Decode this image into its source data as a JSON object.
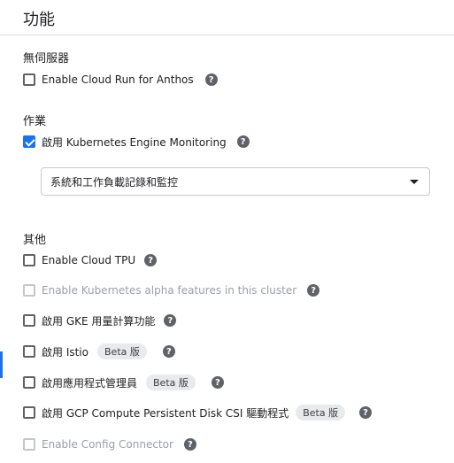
{
  "title": "功能",
  "sections": {
    "serverless": {
      "title": "無伺服器",
      "items": [
        {
          "label": "Enable Cloud Run for Anthos",
          "checked": false,
          "disabled": false
        }
      ]
    },
    "operations": {
      "title": "作業",
      "items": [
        {
          "label": "啟用 Kubernetes Engine Monitoring",
          "checked": true,
          "disabled": false
        }
      ],
      "select": {
        "value": "系統和工作負載記錄和監控"
      }
    },
    "other": {
      "title": "其他",
      "items": [
        {
          "label": "Enable Cloud TPU",
          "checked": false,
          "disabled": false
        },
        {
          "label": "Enable Kubernetes alpha features in this cluster",
          "checked": false,
          "disabled": true
        },
        {
          "label": "啟用 GKE 用量計算功能",
          "checked": false,
          "disabled": false
        },
        {
          "label": "啟用 Istio",
          "checked": false,
          "disabled": false,
          "badge": "Beta 版"
        },
        {
          "label": "啟用應用程式管理員",
          "checked": false,
          "disabled": false,
          "badge": "Beta 版"
        },
        {
          "label": "啟用 GCP Compute Persistent Disk CSI 驅動程式",
          "checked": false,
          "disabled": false,
          "badge": "Beta 版"
        },
        {
          "label": "Enable Config Connector",
          "checked": false,
          "disabled": true
        }
      ]
    }
  },
  "icons": {
    "help": "help-circle-icon",
    "dropdown": "arrow-drop-down-icon",
    "check": "check-icon"
  },
  "help_glyph": "?",
  "colors": {
    "accent": "#1a73e8",
    "text": "#202124",
    "disabled_text": "#9aa0a6",
    "badge_bg": "#e8eaed",
    "divider": "#dadce0"
  }
}
